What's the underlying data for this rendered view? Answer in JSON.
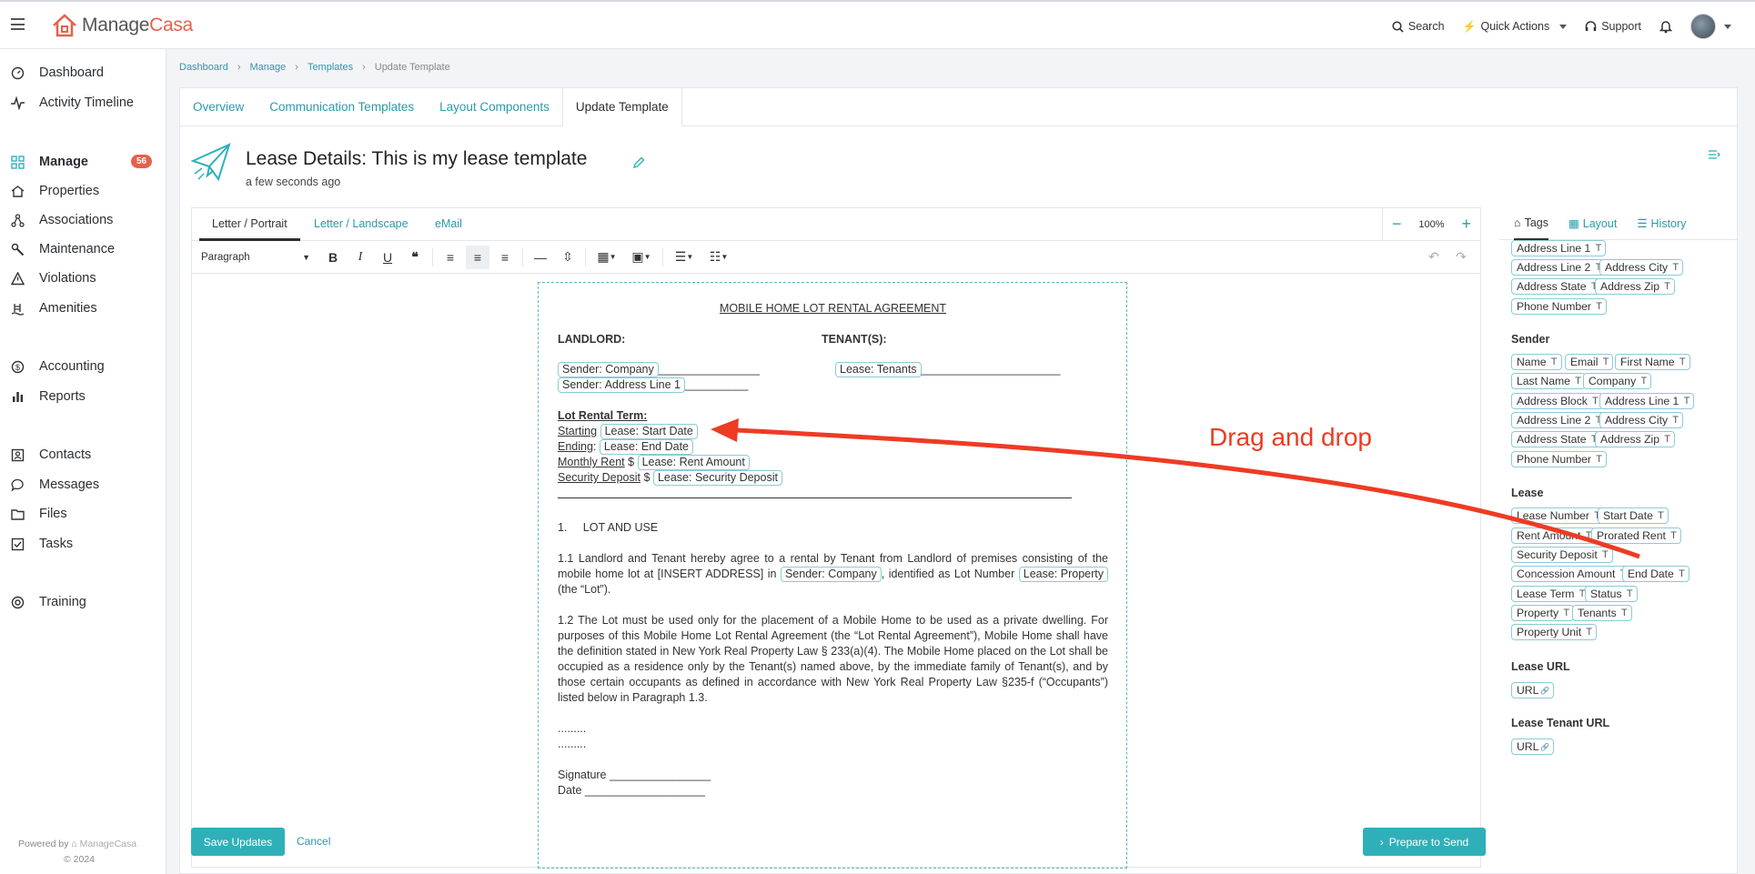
{
  "app": {
    "brand_part1": "Manage",
    "brand_part2": "Casa"
  },
  "topbar": {
    "search": "Search",
    "quick_actions": "Quick Actions",
    "support": "Support"
  },
  "sidebar": {
    "items": [
      {
        "label": "Dashboard"
      },
      {
        "label": "Activity Timeline"
      },
      {
        "label": "Manage",
        "badge": "56"
      },
      {
        "label": "Properties"
      },
      {
        "label": "Associations"
      },
      {
        "label": "Maintenance"
      },
      {
        "label": "Violations"
      },
      {
        "label": "Amenities"
      },
      {
        "label": "Accounting"
      },
      {
        "label": "Reports"
      },
      {
        "label": "Contacts"
      },
      {
        "label": "Messages"
      },
      {
        "label": "Files"
      },
      {
        "label": "Tasks"
      },
      {
        "label": "Training"
      }
    ],
    "powered_by": "Powered by",
    "powered_brand": "ManageCasa",
    "copyright": "© 2024"
  },
  "breadcrumb": [
    "Dashboard",
    "Manage",
    "Templates",
    "Update Template"
  ],
  "main_tabs": [
    "Overview",
    "Communication Templates",
    "Layout Components",
    "Update Template"
  ],
  "page": {
    "title": "Lease Details: This is my lease template",
    "subtitle": "a few seconds ago"
  },
  "editor": {
    "tabs": [
      "Letter / Portrait",
      "Letter / Landscape",
      "eMail"
    ],
    "zoom": "100%",
    "paragraph_style": "Paragraph"
  },
  "doc": {
    "heading": "MOBILE HOME LOT RENTAL AGREEMENT",
    "landlord": "LANDLORD:",
    "tenants": "TENANT(S):",
    "chip_sender_company": "Sender: Company",
    "chip_sender_address": "Sender: Address Line 1",
    "chip_lease_tenants": "Lease: Tenants",
    "lot_rental_term": "Lot Rental Term:",
    "starting": "Starting",
    "chip_start": "Lease: Start Date",
    "ending": "Ending",
    "chip_end": "Lease: End Date",
    "monthly_rent": "Monthly Rent",
    "dollar": "$",
    "chip_rent": "Lease: Rent Amount",
    "security_deposit": "Security Deposit",
    "chip_deposit": "Lease: Security Deposit",
    "section1": "1.     LOT AND USE",
    "p11_a": "1.1       Landlord and Tenant hereby agree to a rental by Tenant from Landlord of premises consisting of the mobile home lot at [INSERT ADDRESS] in",
    "chip_sender_company2": "Sender: Company",
    "p11_b": ", identified as Lot Number",
    "chip_property": "Lease: Property",
    "p11_c": "(the “Lot”).",
    "p12": "1.2       The Lot must be used only for the placement of a Mobile Home to be used as a private dwelling. For purposes of this Mobile Home Lot Rental Agreement (the “Lot Rental Agreement”), Mobile Home shall have the definition stated in New York Real Property Law § 233(a)(4). The Mobile Home placed on the Lot shall be occupied as a residence only by the Tenant(s) named above, by the immediate family of Tenant(s), and by those certain occupants as defined in accordance with New York Real Property Law §235-f (“Occupants”) listed below in Paragraph 1.3.",
    "dots1": ".........",
    "dots2": ".........",
    "signature": "Signature ________________",
    "date": "Date ___________________"
  },
  "buttons": {
    "save": "Save Updates",
    "cancel": "Cancel",
    "prepare": "Prepare to Send"
  },
  "right_panel": {
    "tabs": [
      "Tags",
      "Layout",
      "History"
    ],
    "top_tags": [
      "Address Line 1",
      "Address Line 2",
      "Address City",
      "Address State",
      "Address Zip",
      "Phone Number"
    ],
    "sender_title": "Sender",
    "sender_tags": [
      "Name",
      "Email",
      "First Name",
      "Last Name",
      "Company",
      "Address Block",
      "Address Line 1",
      "Address Line 2",
      "Address City",
      "Address State",
      "Address Zip",
      "Phone Number"
    ],
    "lease_title": "Lease",
    "lease_tags": [
      "Lease Number",
      "Start Date",
      "Rent Amount",
      "Prorated Rent",
      "Security Deposit",
      "Concession Amount",
      "End Date",
      "Lease Term",
      "Status",
      "Property",
      "Tenants",
      "Property Unit"
    ],
    "lease_url_title": "Lease URL",
    "lease_url_tag": "URL",
    "lease_tenant_url_title": "Lease Tenant URL",
    "lease_tenant_url_tag": "URL"
  },
  "annotation": {
    "text": "Drag and drop",
    "color": "#ee3b24"
  },
  "colors": {
    "accent": "#2fb0b9",
    "brand": "#e8604c"
  }
}
